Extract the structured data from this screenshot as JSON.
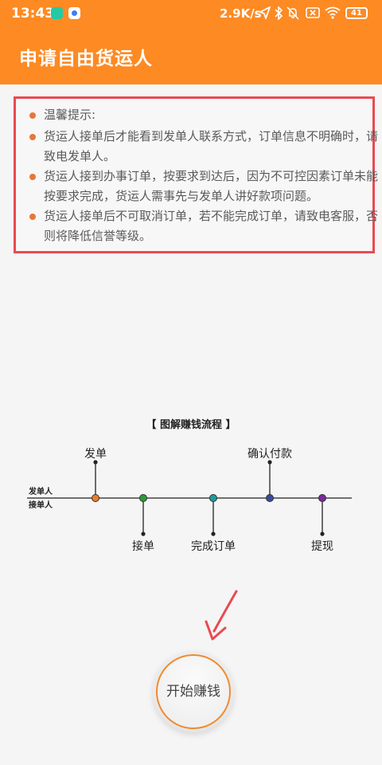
{
  "status_bar": {
    "time": "13:43",
    "speed": "2.9K/s",
    "battery": "41"
  },
  "header": {
    "title": "申请自由货运人"
  },
  "notice": {
    "lines": [
      "温馨提示:",
      "货运人接单后才能看到发单人联系方式，订单信息不明确时，请",
      "致电发单人。",
      "货运人接到办事订单，按要求到达后，因为不可控因素订单未能",
      "按要求完成，货运人需事先与发单人讲好款项问题。",
      "货运人接单后不可取消订单，若不能完成订单，请致电客服，否",
      "则将降低信誉等级。"
    ]
  },
  "diagram": {
    "title": "【 图解赚钱流程 】",
    "row_labels": [
      "发单人",
      "接单人"
    ],
    "steps": [
      {
        "label": "发单",
        "side": "top",
        "color": "#f07a2a"
      },
      {
        "label": "接单",
        "side": "bottom",
        "color": "#2e9a3a"
      },
      {
        "label": "完成订单",
        "side": "bottom",
        "color": "#1f9a9a"
      },
      {
        "label": "确认付款",
        "side": "top",
        "color": "#3a4aa0"
      },
      {
        "label": "提现",
        "side": "bottom",
        "color": "#7a2a9a"
      }
    ]
  },
  "actions": {
    "start_label": "开始赚钱"
  },
  "colors": {
    "brand": "#fd8a23",
    "notice_border": "#ea4a52",
    "bullet": "#e8763a",
    "arrow": "#ea4a52"
  }
}
